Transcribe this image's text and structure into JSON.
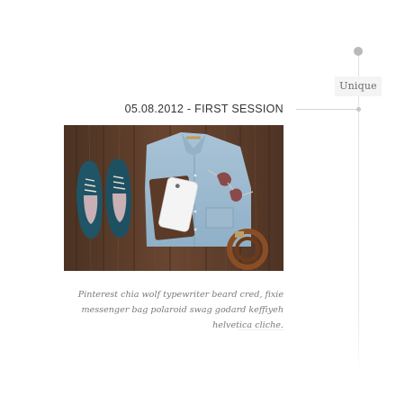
{
  "timeline": {
    "tag_label": "Unique"
  },
  "entry": {
    "title": "05.08.2012 - FIRST SESSION",
    "caption": "Pinterest chia wolf typewriter beard cred, fixie messenger bag polaroid swag godard keffiyeh helvetica cliche."
  },
  "colors": {
    "timeline_line": "#e2e2e2",
    "dot": "#b9b9b9",
    "title_text": "#333333",
    "caption_text": "#7a7a7a",
    "tag_background": "#f4f4f4"
  }
}
